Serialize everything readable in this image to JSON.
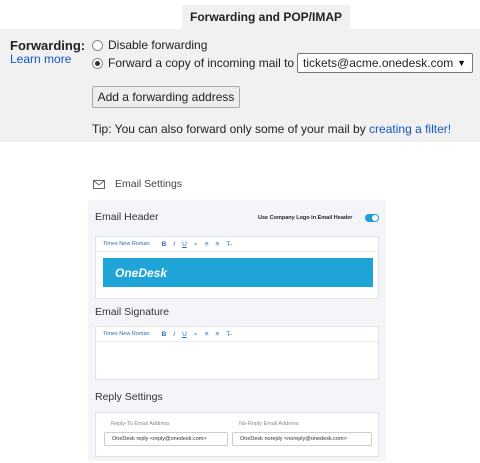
{
  "gmail": {
    "tab_title": "Forwarding and POP/IMAP",
    "forwarding_label": "Forwarding:",
    "learn_more": "Learn more",
    "disable_option": "Disable forwarding",
    "forward_option": "Forward a copy of incoming mail to",
    "forward_address": "tickets@acme.onedesk.com",
    "add_button": "Add a forwarding address",
    "tip_text": "Tip: You can also forward only some of your mail by",
    "tip_link": "creating a filter!",
    "selected_option": "forward"
  },
  "onedesk": {
    "title": "Email Settings",
    "header_section": "Email Header",
    "logo_toggle_label": "Use Company Logo in Email Header",
    "logo_toggle_on": true,
    "toolbar_font": "Times New Roman",
    "toolbar_buttons": [
      "B",
      "I",
      "U",
      "link",
      "ordered-list",
      "bullet-list",
      "clear-format"
    ],
    "banner_text": "OneDesk",
    "signature_section": "Email Signature",
    "reply_section": "Reply Settings",
    "reply_to_label": "Reply-To Email Address",
    "reply_to_value": "OneDesk reply <reply@onedesk.com>",
    "noreply_label": "No-Reply Email Address",
    "noreply_value": "OneDesk noreply <noreply@onedesk.com>",
    "accent_color": "#1ea4d6"
  }
}
